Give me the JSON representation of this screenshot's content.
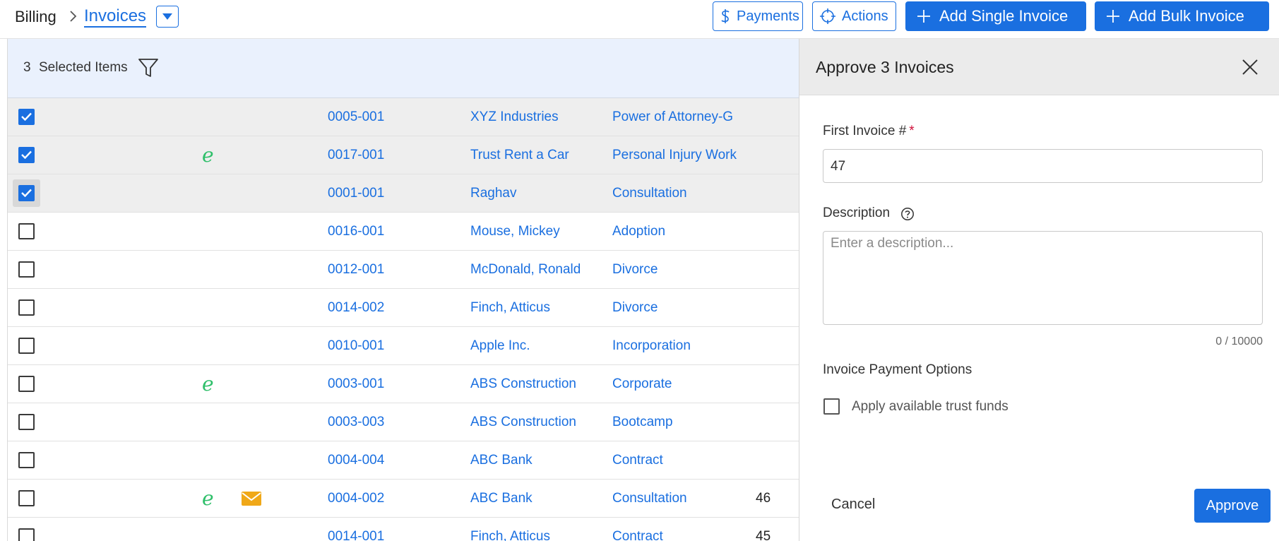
{
  "header": {
    "breadcrumb_root": "Billing",
    "breadcrumb_current": "Invoices",
    "payments_label": "Payments",
    "actions_label": "Actions",
    "add_single_label": "Add Single Invoice",
    "add_bulk_label": "Add Bulk Invoice"
  },
  "selection": {
    "count": "3",
    "label": "Selected Items"
  },
  "rows": [
    {
      "checked": true,
      "e": false,
      "mail": false,
      "num": "0005-001",
      "client": "XYZ Industries",
      "matter": "Power of Attorney-G",
      "amount": ""
    },
    {
      "checked": true,
      "e": true,
      "mail": false,
      "num": "0017-001",
      "client": "Trust Rent a Car",
      "matter": "Personal Injury Work",
      "amount": ""
    },
    {
      "checked": true,
      "e": false,
      "mail": false,
      "num": "0001-001",
      "client": "Raghav",
      "matter": "Consultation",
      "amount": ""
    },
    {
      "checked": false,
      "e": false,
      "mail": false,
      "num": "0016-001",
      "client": "Mouse, Mickey",
      "matter": "Adoption",
      "amount": ""
    },
    {
      "checked": false,
      "e": false,
      "mail": false,
      "num": "0012-001",
      "client": "McDonald, Ronald",
      "matter": "Divorce",
      "amount": ""
    },
    {
      "checked": false,
      "e": false,
      "mail": false,
      "num": "0014-002",
      "client": "Finch, Atticus",
      "matter": "Divorce",
      "amount": ""
    },
    {
      "checked": false,
      "e": false,
      "mail": false,
      "num": "0010-001",
      "client": "Apple Inc.",
      "matter": "Incorporation",
      "amount": ""
    },
    {
      "checked": false,
      "e": true,
      "mail": false,
      "num": "0003-001",
      "client": "ABS Construction",
      "matter": "Corporate",
      "amount": ""
    },
    {
      "checked": false,
      "e": false,
      "mail": false,
      "num": "0003-003",
      "client": "ABS Construction",
      "matter": "Bootcamp",
      "amount": ""
    },
    {
      "checked": false,
      "e": false,
      "mail": false,
      "num": "0004-004",
      "client": "ABC Bank",
      "matter": "Contract",
      "amount": ""
    },
    {
      "checked": false,
      "e": true,
      "mail": true,
      "num": "0004-002",
      "client": "ABC Bank",
      "matter": "Consultation",
      "amount": "46"
    },
    {
      "checked": false,
      "e": false,
      "mail": false,
      "num": "0014-001",
      "client": "Finch, Atticus",
      "matter": "Contract",
      "amount": "45"
    }
  ],
  "panel": {
    "title": "Approve 3 Invoices",
    "first_invoice_label": "First Invoice #",
    "required_mark": "*",
    "first_invoice_value": "47",
    "description_label": "Description",
    "description_placeholder": "Enter a description...",
    "counter": "0 / 10000",
    "payment_options_label": "Invoice Payment Options",
    "trust_funds_label": "Apply available trust funds",
    "cancel_label": "Cancel",
    "approve_label": "Approve"
  },
  "icons": {
    "row_e": "e",
    "e_color": "#2fbf6a",
    "mail_color": "#f0a818",
    "accent": "#1a6fe0"
  }
}
